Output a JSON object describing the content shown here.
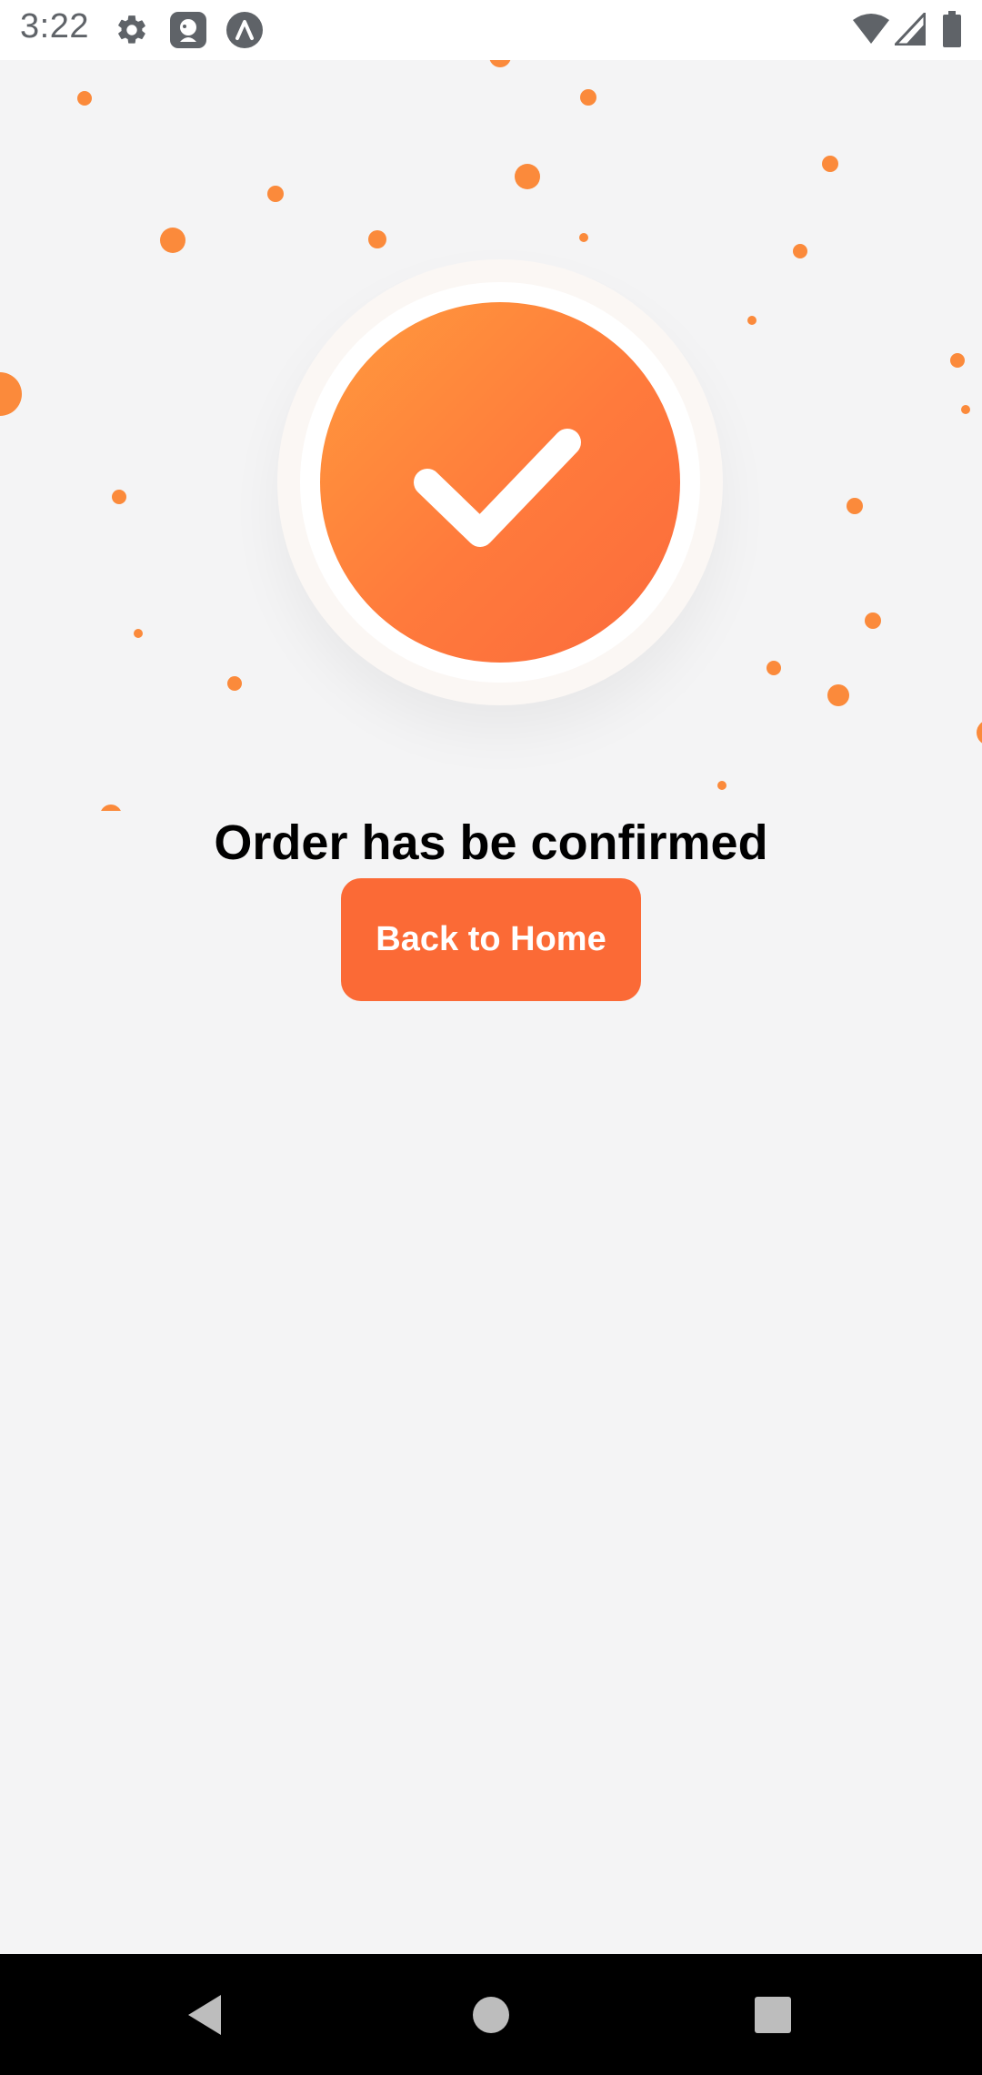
{
  "status_bar": {
    "time": "3:22",
    "icons": [
      "gear-icon",
      "app-notification-icon",
      "lambda-notification-icon",
      "wifi-icon",
      "signal-icon",
      "battery-icon"
    ]
  },
  "confirmation": {
    "icon": "check-icon",
    "title": "Order has be confirmed",
    "accent_color": "#fb6a36"
  },
  "actions": {
    "home_button_label": "Back to Home"
  },
  "nav_bar": {
    "buttons": [
      "back-icon",
      "home-icon",
      "recents-icon"
    ]
  }
}
